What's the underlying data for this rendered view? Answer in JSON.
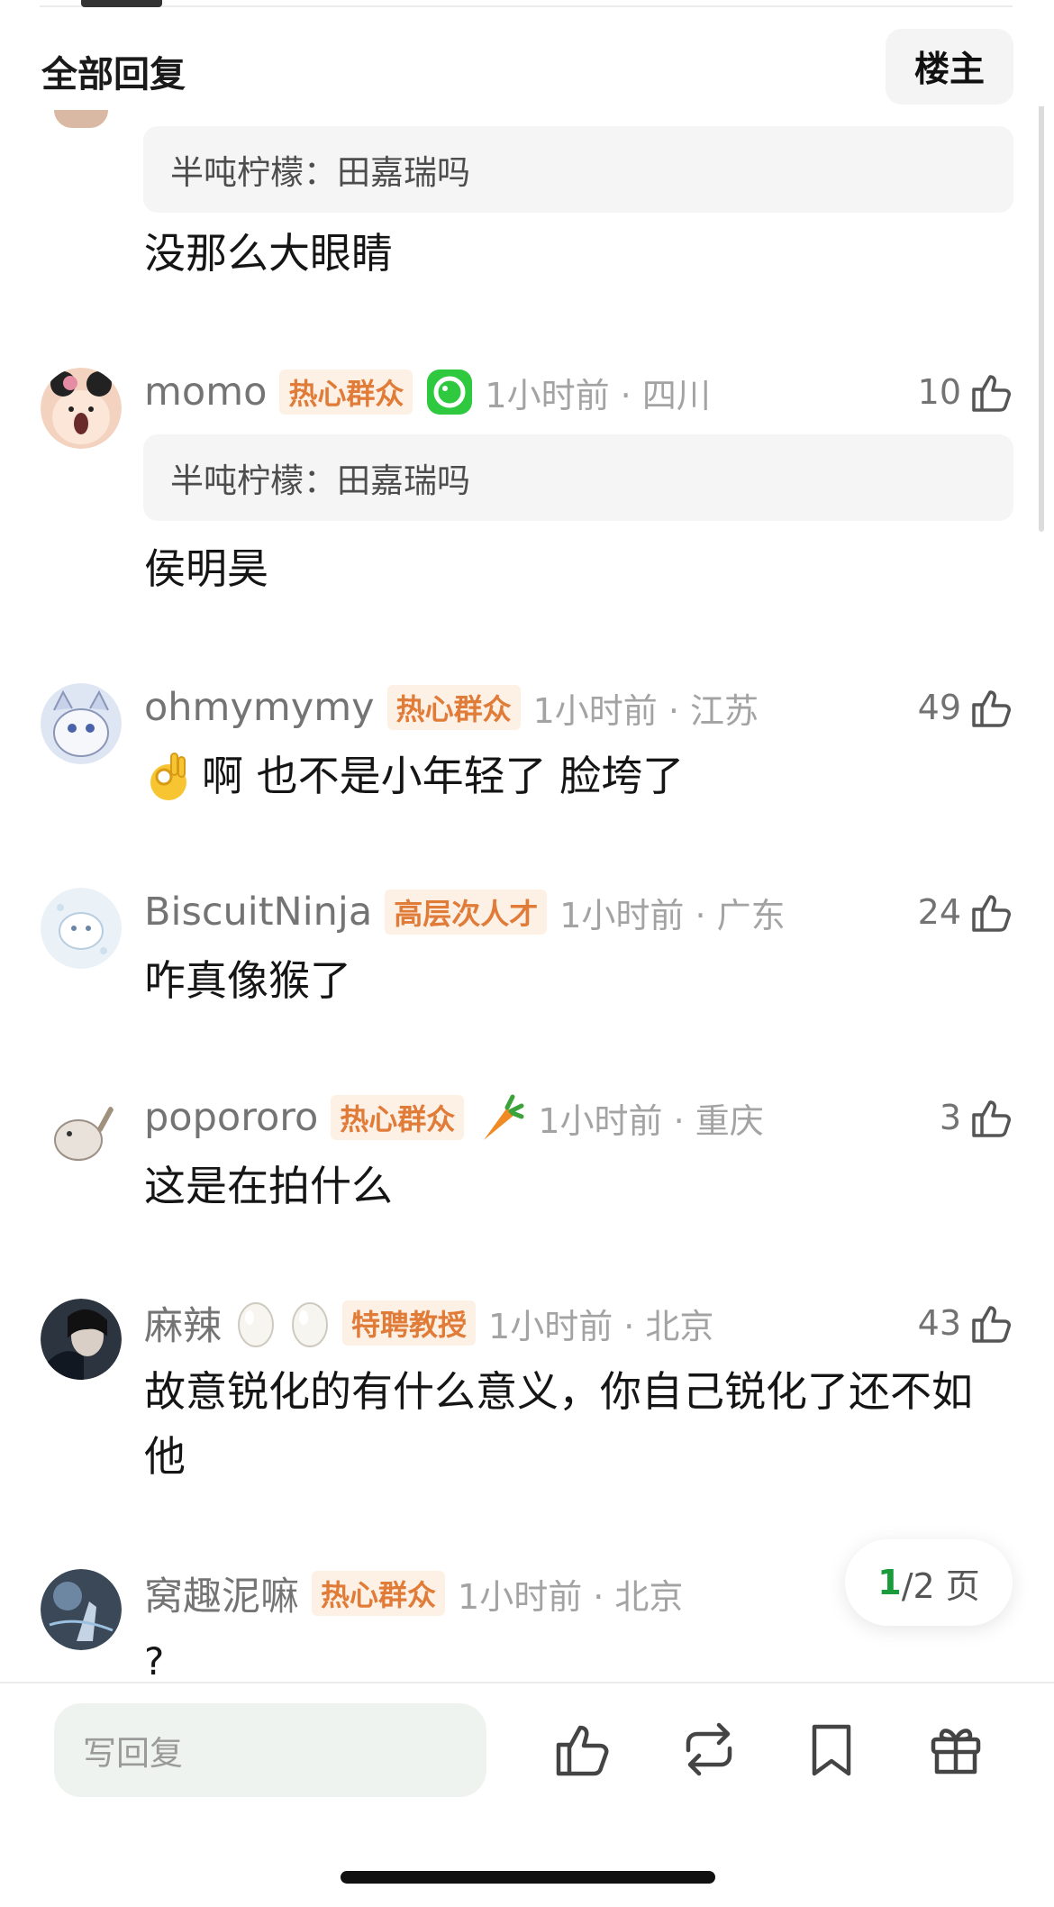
{
  "header": {
    "title": "全部回复",
    "owner_button": "楼主"
  },
  "comments": [
    {
      "quote_user": "半吨柠檬：",
      "quote_text": "田嘉瑞吗",
      "text": "没那么大眼睛"
    },
    {
      "username": "momo",
      "badge": "热心群众",
      "time_location": "1小时前 · 四川",
      "likes": "10",
      "quote_user": "半吨柠檬：",
      "quote_text": "田嘉瑞吗",
      "text": "侯明昊"
    },
    {
      "username": "ohmymymy",
      "badge": "热心群众",
      "time_location": "1小时前 · 江苏",
      "likes": "49",
      "text": "啊 也不是小年轻了 脸垮了"
    },
    {
      "username": "BiscuitNinja",
      "badge": "高层次人才",
      "time_location": "1小时前 · 广东",
      "likes": "24",
      "text": "咋真像猴了"
    },
    {
      "username": "popororo",
      "badge": "热心群众",
      "time_location": "1小时前 · 重庆",
      "likes": "3",
      "text": "这是在拍什么"
    },
    {
      "username": "麻辣",
      "badge": "特聘教授",
      "time_location": "1小时前 · 北京",
      "likes": "43",
      "text": "故意锐化的有什么意义，你自己锐化了还不如他"
    },
    {
      "username": "窝趣泥嘛",
      "badge": "热心群众",
      "time_location": "1小时前 · 北京",
      "text": "?"
    }
  ],
  "pagination": {
    "current": "1",
    "rest": "/2 页"
  },
  "footer": {
    "reply_placeholder": "写回复"
  },
  "colors": {
    "badge": "#e07b38",
    "accent_green": "#1a9c3c",
    "muted": "#a3a3a3"
  },
  "icons": [
    "thumbs-up-icon",
    "repost-icon",
    "bookmark-icon",
    "gift-icon",
    "ok-hand-emoji",
    "carrot-emoji",
    "egg-emoji"
  ]
}
